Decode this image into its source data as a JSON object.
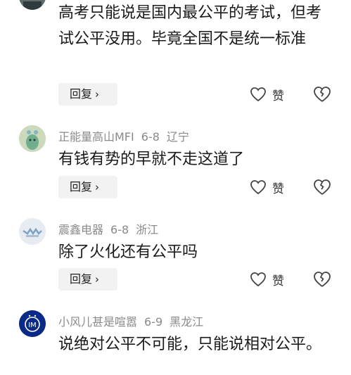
{
  "comments": [
    {
      "username": "",
      "date": "",
      "location": "",
      "text": "高考只能说是国内最公平的考试，但考试公平没用。毕竟全国不是统一标准",
      "reply_label": "回复",
      "like_label": "赞"
    },
    {
      "username": "正能量高山MFI",
      "date": "6-8",
      "location": "辽宁",
      "text": "有钱有势的早就不走这道了",
      "reply_label": "回复",
      "like_label": "赞"
    },
    {
      "username": "震鑫电器",
      "date": "6-8",
      "location": "浙江",
      "text": "除了火化还有公平吗",
      "reply_label": "回复",
      "like_label": "赞"
    },
    {
      "username": "小风儿甚是喧嚣",
      "date": "6-9",
      "location": "黑龙江",
      "text": "说绝对公平不可能，只能说相对公平。",
      "reply_label": "回复",
      "like_label": "赞"
    }
  ],
  "icons": {
    "reply_chevron": "chevron-right-icon",
    "like": "heart-outline-icon",
    "dislike": "broken-heart-icon"
  },
  "colors": {
    "meta_text": "#8a8a8a",
    "reply_bg": "#f2f2f2",
    "body_text": "#1a1a1a"
  }
}
